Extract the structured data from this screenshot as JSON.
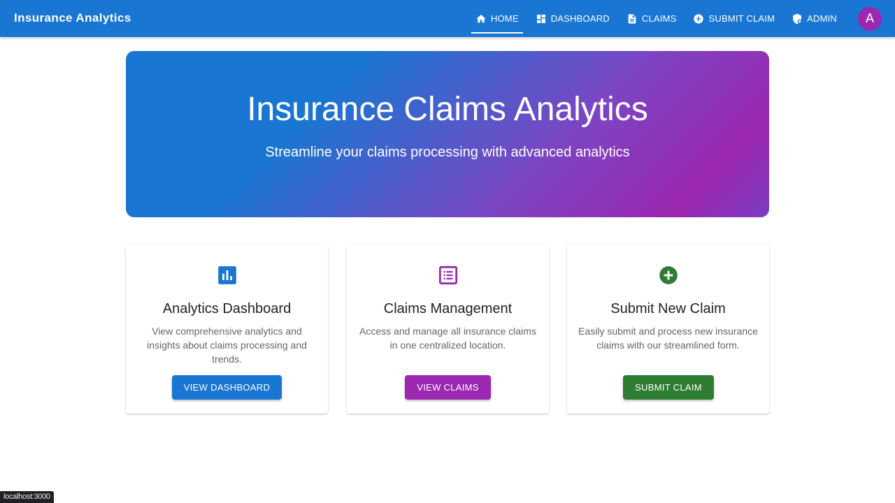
{
  "appbar": {
    "brand": "Insurance Analytics",
    "nav": [
      {
        "label": "HOME",
        "icon": "home-icon",
        "active": true
      },
      {
        "label": "DASHBOARD",
        "icon": "dashboard-icon",
        "active": false
      },
      {
        "label": "CLAIMS",
        "icon": "document-icon",
        "active": false
      },
      {
        "label": "SUBMIT CLAIM",
        "icon": "add-circle-icon",
        "active": false
      },
      {
        "label": "ADMIN",
        "icon": "admin-shield-icon",
        "active": false
      }
    ],
    "avatar": "A",
    "color": "#1976d2"
  },
  "hero": {
    "title": "Insurance Claims Analytics",
    "subtitle": "Streamline your claims processing with advanced analytics",
    "gradient_from": "#1976d2",
    "gradient_to": "#9c27b0"
  },
  "cards": [
    {
      "icon": "bar-chart-icon",
      "title": "Analytics Dashboard",
      "description": "View comprehensive analytics and insights about claims processing and trends.",
      "button": "VIEW DASHBOARD",
      "color": "#1976d2"
    },
    {
      "icon": "list-icon",
      "title": "Claims Management",
      "description": "Access and manage all insurance claims in one centralized location.",
      "button": "VIEW CLAIMS",
      "color": "#9c27b0"
    },
    {
      "icon": "add-circle-icon",
      "title": "Submit New Claim",
      "description": "Easily submit and process new insurance claims with our streamlined form.",
      "button": "SUBMIT CLAIM",
      "color": "#2e7d32"
    }
  ],
  "status_url": "localhost:3000"
}
